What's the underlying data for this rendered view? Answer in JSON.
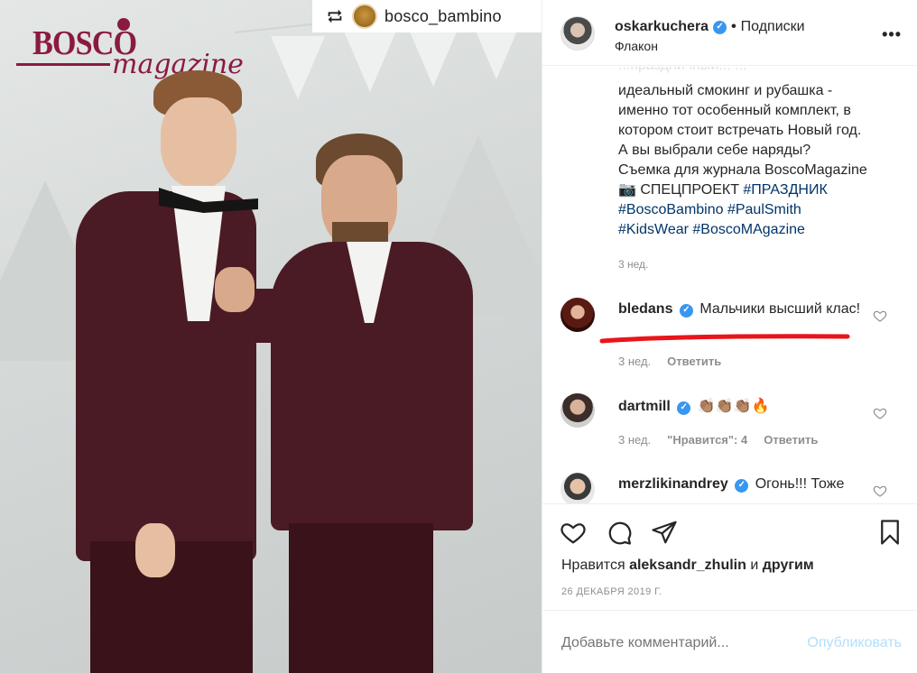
{
  "photo": {
    "logo_word": "BOSCO",
    "logo_script": "magazine"
  },
  "repost": {
    "username": "bosco_bambino",
    "repost_icon": "repost-icon"
  },
  "post_header": {
    "username": "oskarkuchera",
    "separator": "•",
    "follow_label": "Подписки",
    "subtitle": "Флакон",
    "more_label": "•••"
  },
  "caption": {
    "clipped_top": "...праздничный... ...",
    "lines": [
      "идеальный смокинг и рубашка -",
      "именно тот особенный комплект, в",
      "котором стоит встречать Новый год.",
      "А вы выбрали себе наряды?",
      "Съемка для журнала BoscoMagazine",
      "📷 СПЕЦПРОЕКТ "
    ],
    "tag_inline": "#ПРАЗДНИК",
    "tag_line1": "#BoscoBambino #PaulSmith",
    "tag_line2": "#KidsWear #BoscoMAgazine",
    "time": "3 нед."
  },
  "comments": [
    {
      "username": "bledans",
      "text": "Мальчики высший клас!",
      "time": "3 нед.",
      "reply": "Ответить"
    },
    {
      "username": "dartmill",
      "text": "👏🏽👏🏽👏🏽🔥",
      "time": "3 нед.",
      "likes": "\"Нравится\": 4",
      "reply": "Ответить"
    },
    {
      "username": "merzlikinandrey",
      "text": "Огонь!!! Тоже"
    }
  ],
  "likes": {
    "prefix": "Нравится",
    "user": "aleksandr_zhulin",
    "middle": "и",
    "suffix": "другим"
  },
  "date": "26 ДЕКАБРЯ 2019 Г.",
  "add_comment": {
    "placeholder": "Добавьте комментарий...",
    "post_label": "Опубликовать"
  },
  "colors": {
    "accent_blue": "#3897f0",
    "hashtag": "#003569",
    "muted": "#8e8e8e",
    "underline_red": "#e8151b",
    "brand_maroon": "#8a1b3e"
  }
}
